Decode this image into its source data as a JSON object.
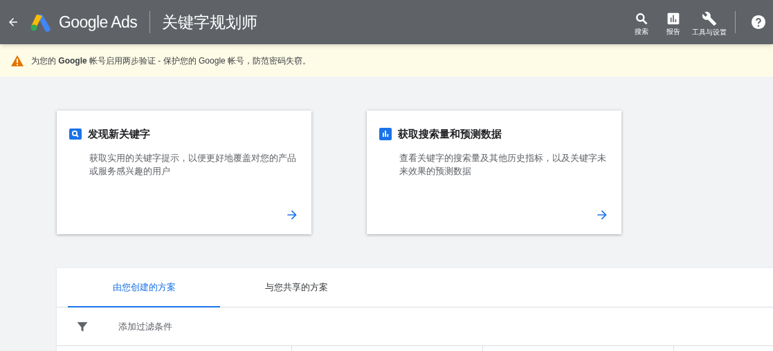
{
  "header": {
    "brand": "Google Ads",
    "title": "关键字规划师",
    "actions": [
      {
        "kind": "search",
        "label": "搜索"
      },
      {
        "kind": "report",
        "label": "报告"
      },
      {
        "kind": "tools",
        "label": "工具与设置"
      }
    ]
  },
  "banner": {
    "text": "为您的 **Google** 帐号启用两步验证 - 保护您的 Google 帐号，防范密码失窃。"
  },
  "cards": [
    {
      "kind": "search",
      "title": "发现新关键字",
      "description": "获取实用的关键字提示，以便更好地覆盖对您的产品或服务感兴趣的用户"
    },
    {
      "kind": "chart",
      "title": "获取搜索量和预测数据",
      "description": "查看关键字的搜索量及其他历史指标，以及关键字未来效果的预测数据"
    }
  ],
  "tabs": [
    {
      "label": "由您创建的方案",
      "selected": true
    },
    {
      "label": "与您共享的方案",
      "selected": false
    }
  ],
  "filter": {
    "label": "添加过滤条件"
  }
}
